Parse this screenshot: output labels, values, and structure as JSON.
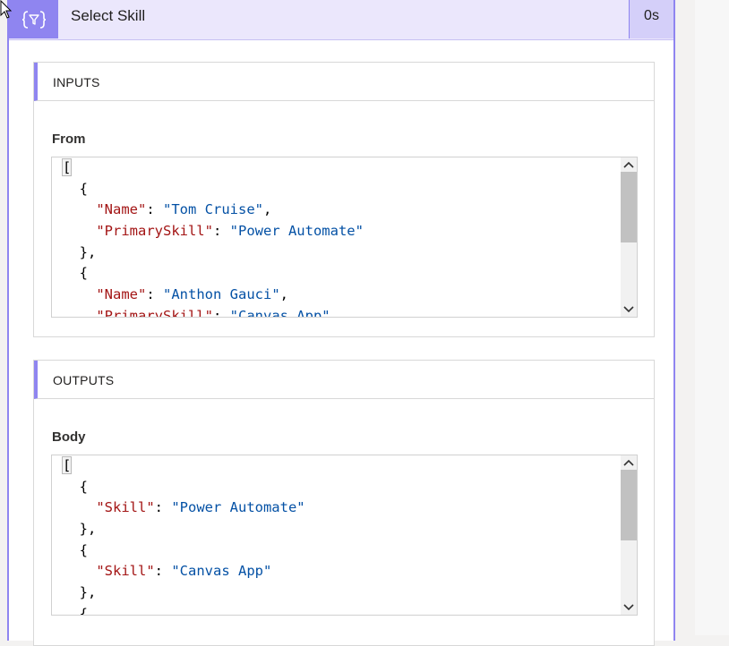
{
  "header": {
    "icon": "curly-filter-icon",
    "title": "Select Skill",
    "duration": "0s"
  },
  "inputs": {
    "section_title": "INPUTS",
    "field_label": "From",
    "code_lines": [
      {
        "indent": "",
        "parts": [
          {
            "t": "p",
            "v": "["
          }
        ]
      },
      {
        "indent": "  ",
        "parts": [
          {
            "t": "p",
            "v": "{"
          }
        ]
      },
      {
        "indent": "    ",
        "parts": [
          {
            "t": "k",
            "v": "\"Name\""
          },
          {
            "t": "p",
            "v": ": "
          },
          {
            "t": "s",
            "v": "\"Tom Cruise\""
          },
          {
            "t": "p",
            "v": ","
          }
        ]
      },
      {
        "indent": "    ",
        "parts": [
          {
            "t": "k",
            "v": "\"PrimarySkill\""
          },
          {
            "t": "p",
            "v": ": "
          },
          {
            "t": "s",
            "v": "\"Power Automate\""
          }
        ]
      },
      {
        "indent": "  ",
        "parts": [
          {
            "t": "p",
            "v": "},"
          }
        ]
      },
      {
        "indent": "  ",
        "parts": [
          {
            "t": "p",
            "v": "{"
          }
        ]
      },
      {
        "indent": "    ",
        "parts": [
          {
            "t": "k",
            "v": "\"Name\""
          },
          {
            "t": "p",
            "v": ": "
          },
          {
            "t": "s",
            "v": "\"Anthon Gauci\""
          },
          {
            "t": "p",
            "v": ","
          }
        ]
      },
      {
        "indent": "    ",
        "parts": [
          {
            "t": "k",
            "v": "\"PrimarySkill\""
          },
          {
            "t": "p",
            "v": ": "
          },
          {
            "t": "s",
            "v": "\"Canvas App\""
          }
        ]
      }
    ]
  },
  "outputs": {
    "section_title": "OUTPUTS",
    "field_label": "Body",
    "code_lines": [
      {
        "indent": "",
        "parts": [
          {
            "t": "p",
            "v": "["
          }
        ]
      },
      {
        "indent": "  ",
        "parts": [
          {
            "t": "p",
            "v": "{"
          }
        ]
      },
      {
        "indent": "    ",
        "parts": [
          {
            "t": "k",
            "v": "\"Skill\""
          },
          {
            "t": "p",
            "v": ": "
          },
          {
            "t": "s",
            "v": "\"Power Automate\""
          }
        ]
      },
      {
        "indent": "  ",
        "parts": [
          {
            "t": "p",
            "v": "},"
          }
        ]
      },
      {
        "indent": "  ",
        "parts": [
          {
            "t": "p",
            "v": "{"
          }
        ]
      },
      {
        "indent": "    ",
        "parts": [
          {
            "t": "k",
            "v": "\"Skill\""
          },
          {
            "t": "p",
            "v": ": "
          },
          {
            "t": "s",
            "v": "\"Canvas App\""
          }
        ]
      },
      {
        "indent": "  ",
        "parts": [
          {
            "t": "p",
            "v": "},"
          }
        ]
      },
      {
        "indent": "  ",
        "parts": [
          {
            "t": "p",
            "v": "{"
          }
        ]
      }
    ]
  },
  "colors": {
    "accent": "#8f85f0",
    "header_bg": "#ebe7fc",
    "json_key": "#a31515",
    "json_string": "#0451a5"
  }
}
